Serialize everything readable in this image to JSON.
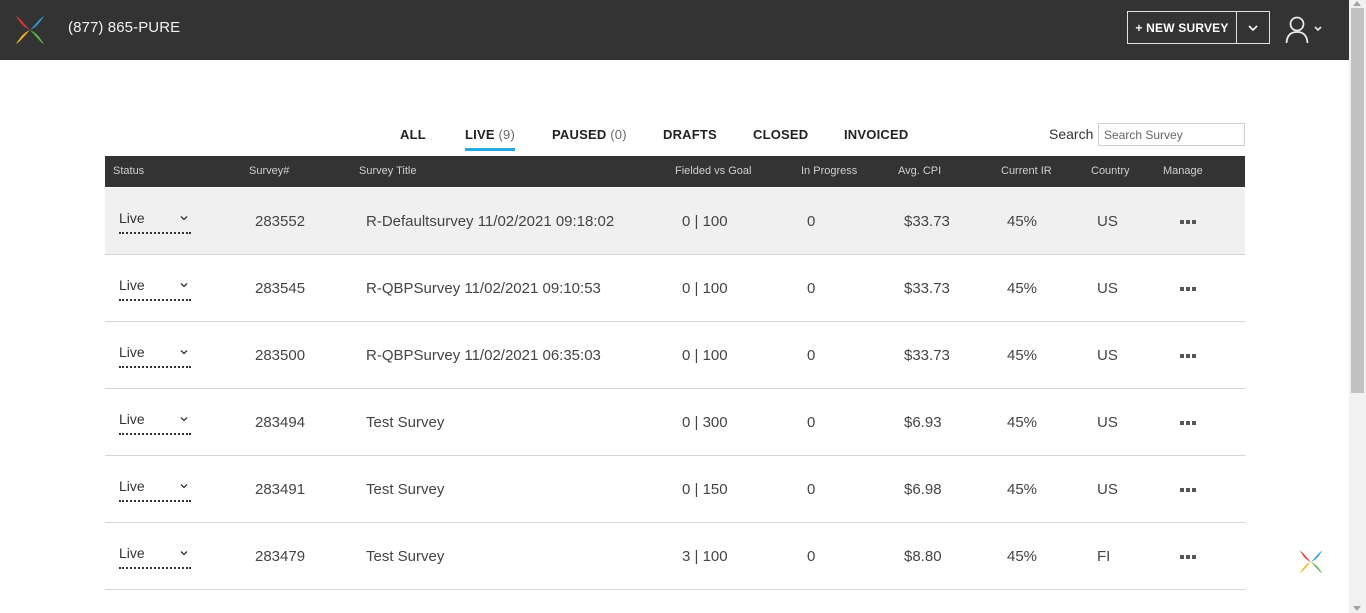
{
  "header": {
    "phone": "(877) 865-PURE",
    "new_survey_label": "+ NEW SURVEY"
  },
  "tabs": [
    {
      "label": "ALL",
      "count": ""
    },
    {
      "label": "LIVE",
      "count": "(9)"
    },
    {
      "label": "PAUSED",
      "count": "(0)"
    },
    {
      "label": "DRAFTS",
      "count": ""
    },
    {
      "label": "CLOSED",
      "count": ""
    },
    {
      "label": "INVOICED",
      "count": ""
    }
  ],
  "active_tab": "LIVE",
  "search": {
    "label": "Search",
    "placeholder": "Search Survey"
  },
  "table": {
    "columns": [
      "Status",
      "Survey#",
      "Survey Title",
      "Fielded vs Goal",
      "In Progress",
      "Avg. CPI",
      "Current IR",
      "Country",
      "Manage"
    ],
    "rows": [
      {
        "status": "Live",
        "id": "283552",
        "title": "R-Defaultsurvey 11/02/2021 09:18:02",
        "fielded": "0 | 100",
        "in_progress": "0",
        "cpi": "$33.73",
        "ir": "45%",
        "country": "US"
      },
      {
        "status": "Live",
        "id": "283545",
        "title": "R-QBPSurvey 11/02/2021 09:10:53",
        "fielded": "0 | 100",
        "in_progress": "0",
        "cpi": "$33.73",
        "ir": "45%",
        "country": "US"
      },
      {
        "status": "Live",
        "id": "283500",
        "title": "R-QBPSurvey 11/02/2021 06:35:03",
        "fielded": "0 | 100",
        "in_progress": "0",
        "cpi": "$33.73",
        "ir": "45%",
        "country": "US"
      },
      {
        "status": "Live",
        "id": "283494",
        "title": "Test Survey",
        "fielded": "0 | 300",
        "in_progress": "0",
        "cpi": "$6.93",
        "ir": "45%",
        "country": "US"
      },
      {
        "status": "Live",
        "id": "283491",
        "title": "Test Survey",
        "fielded": "0 | 150",
        "in_progress": "0",
        "cpi": "$6.98",
        "ir": "45%",
        "country": "US"
      },
      {
        "status": "Live",
        "id": "283479",
        "title": "Test Survey",
        "fielded": "3 | 100",
        "in_progress": "0",
        "cpi": "$8.80",
        "ir": "45%",
        "country": "FI"
      }
    ]
  },
  "colors": {
    "header_bg": "#333333",
    "tab_underline": "#29a8e0",
    "row_highlight": "#f0f0f0"
  },
  "icons": {
    "logo": "pinwheel-logo-icon",
    "user": "user-icon",
    "caret": "chevron-down-icon",
    "manage": "more-horizontal-icon"
  }
}
